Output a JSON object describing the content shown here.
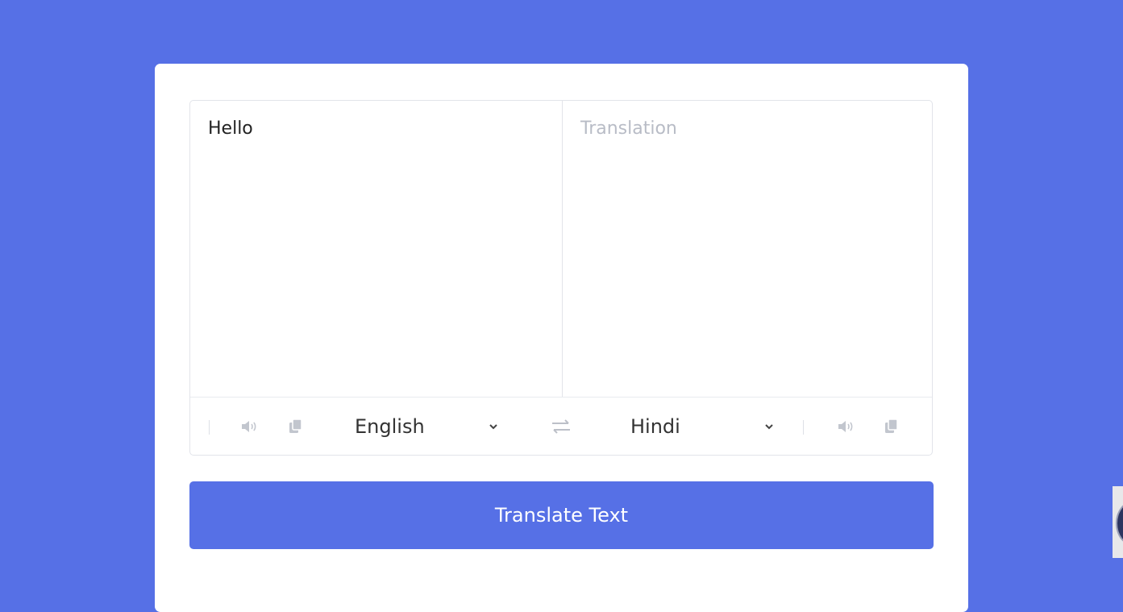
{
  "from_text": {
    "value": "Hello",
    "placeholder": "Enter text"
  },
  "to_text": {
    "value": "",
    "placeholder": "Translation"
  },
  "from_language": {
    "selected": "English"
  },
  "to_language": {
    "selected": "Hindi"
  },
  "translate_button": {
    "label": "Translate Text"
  },
  "icons": {
    "speak": "speaker-icon",
    "copy": "copy-icon",
    "swap": "exchange-icon",
    "dropdown": "chevron-down-icon"
  },
  "colors": {
    "background": "#5670e6",
    "button": "#5670e6",
    "card": "#ffffff"
  }
}
